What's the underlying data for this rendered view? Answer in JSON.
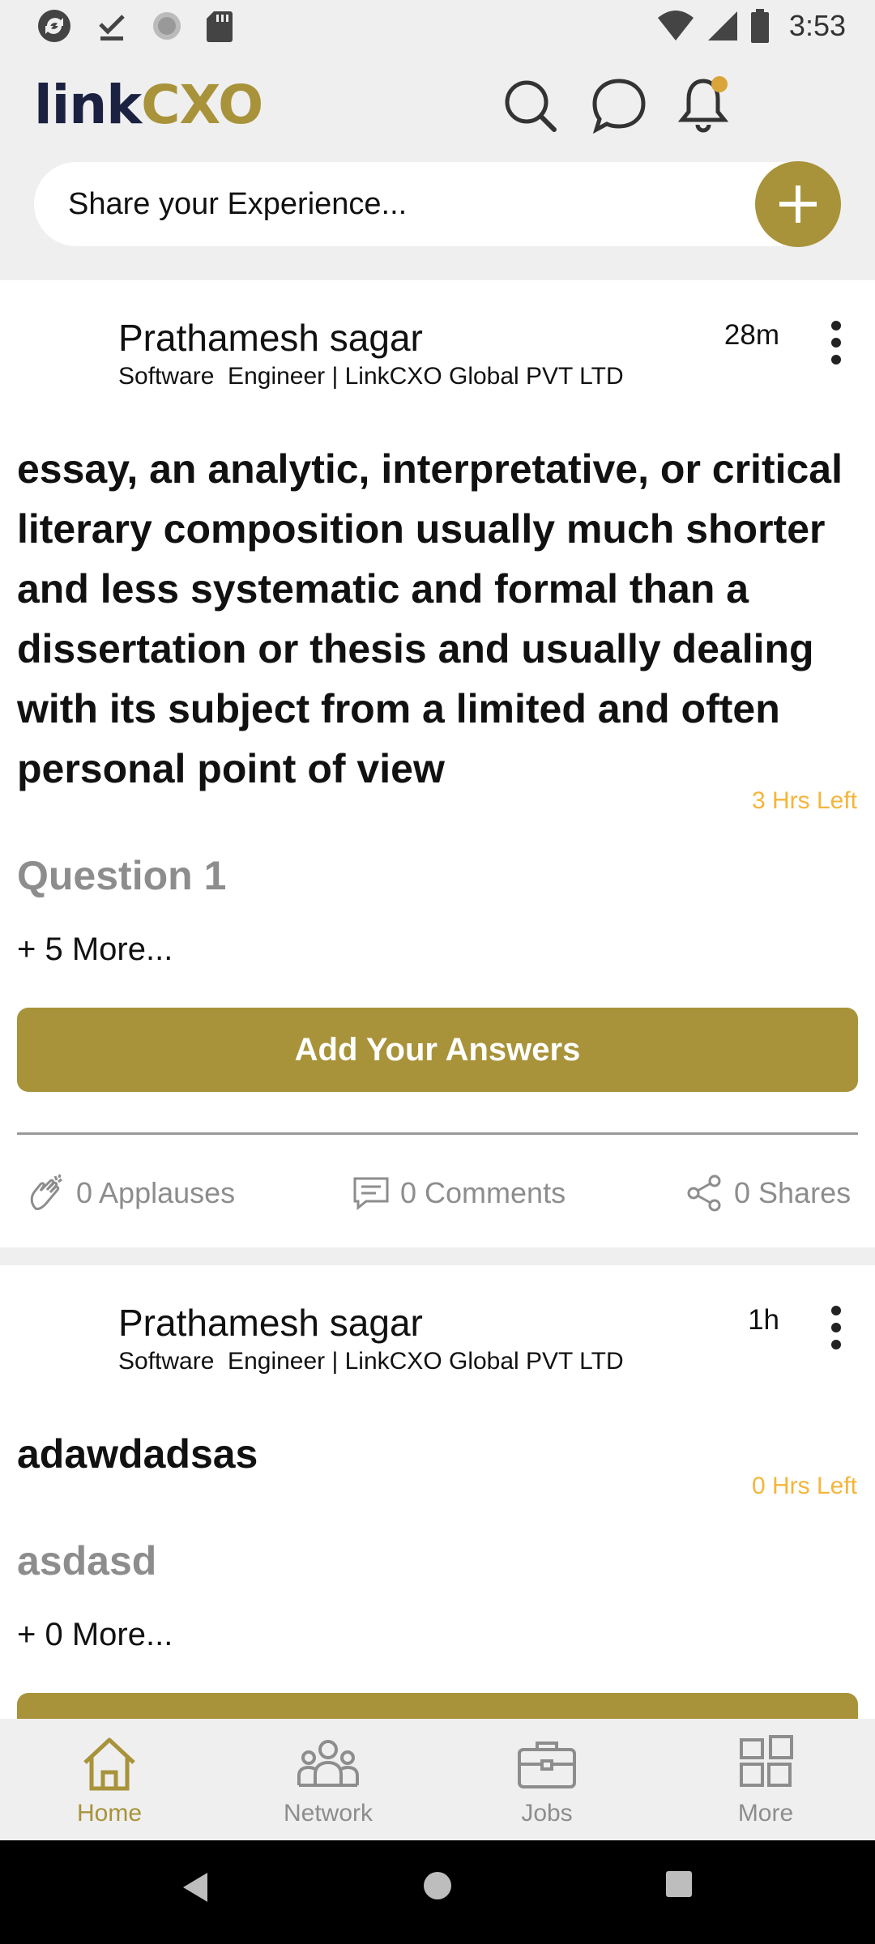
{
  "status_bar": {
    "time": "3:53",
    "left_icons": [
      "sync-icon",
      "download-done-icon",
      "circle-icon",
      "sd-card-icon"
    ],
    "right_icons": [
      "wifi-icon",
      "cell-signal-icon",
      "battery-icon"
    ]
  },
  "header": {
    "logo_text_a": "link",
    "logo_text_b": "CXO",
    "share_placeholder": "Share your Experience...",
    "icons": [
      "search-icon",
      "chat-icon",
      "notification-bell-icon"
    ]
  },
  "posts": [
    {
      "author": "Prathamesh sagar",
      "title": "Software  Engineer | LinkCXO Global PVT LTD",
      "time": "28m",
      "body": "essay, an analytic, interpretative, or critical literary composition usually much shorter and less systematic and formal than a dissertation or thesis and usually dealing with its subject from a limited and often personal point of view",
      "hrs_left": "3 Hrs Left",
      "question": "Question 1",
      "more": "+ 5 More...",
      "answer_label": "Add Your Answers",
      "applauses": "0 Applauses",
      "comments": "0 Comments",
      "shares": "0 Shares"
    },
    {
      "author": "Prathamesh sagar",
      "title": "Software  Engineer | LinkCXO Global PVT LTD",
      "time": "1h",
      "body": "adawdadsas",
      "hrs_left": "0 Hrs Left",
      "question": "asdasd",
      "more": "+ 0 More..."
    }
  ],
  "bottom_nav": [
    {
      "label": "Home",
      "icon": "home-icon",
      "active": true
    },
    {
      "label": "Network",
      "icon": "network-icon",
      "active": false
    },
    {
      "label": "Jobs",
      "icon": "briefcase-icon",
      "active": false
    },
    {
      "label": "More",
      "icon": "grid-icon",
      "active": false
    }
  ],
  "colors": {
    "brand_gold": "#a8933a",
    "brand_navy": "#1b2141",
    "timer_orange": "#f5b53a",
    "muted_gray": "#8d8d8d",
    "background": "#efefef"
  }
}
